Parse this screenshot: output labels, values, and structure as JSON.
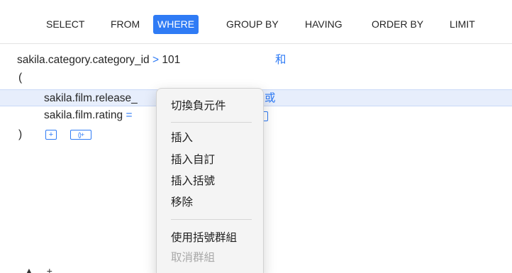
{
  "tabs": [
    {
      "label": "SELECT",
      "active": false
    },
    {
      "label": "FROM",
      "active": false
    },
    {
      "label": "WHERE",
      "active": true
    },
    {
      "label": "GROUP BY",
      "active": false
    },
    {
      "label": "HAVING",
      "active": false
    },
    {
      "label": "ORDER BY",
      "active": false
    },
    {
      "label": "LIMIT",
      "active": false
    }
  ],
  "conditions": {
    "line1": {
      "field": "sakila.category.category_id",
      "operator": ">",
      "value": "101",
      "conjunction": "和"
    },
    "open_paren": "(",
    "line2": {
      "field": "sakila.film.release_",
      "conjunction": "或"
    },
    "line3": {
      "field": "sakila.film.rating",
      "operator": "="
    },
    "close_paren": ")",
    "add_button": "+",
    "add_group_button": "()+"
  },
  "context_menu": {
    "toggle_negation": "切換負元件",
    "insert": "插入",
    "insert_custom": "插入自訂",
    "insert_brackets": "插入括號",
    "remove": "移除",
    "group_with_brackets": "使用括號群組",
    "ungroup": "取消群組"
  },
  "bottom_tools": {
    "up": "▲",
    "add": "+"
  },
  "colors": {
    "accent": "#2f7bf5",
    "highlight": "#e7eefc",
    "menu_bg": "#f4f4f4"
  }
}
